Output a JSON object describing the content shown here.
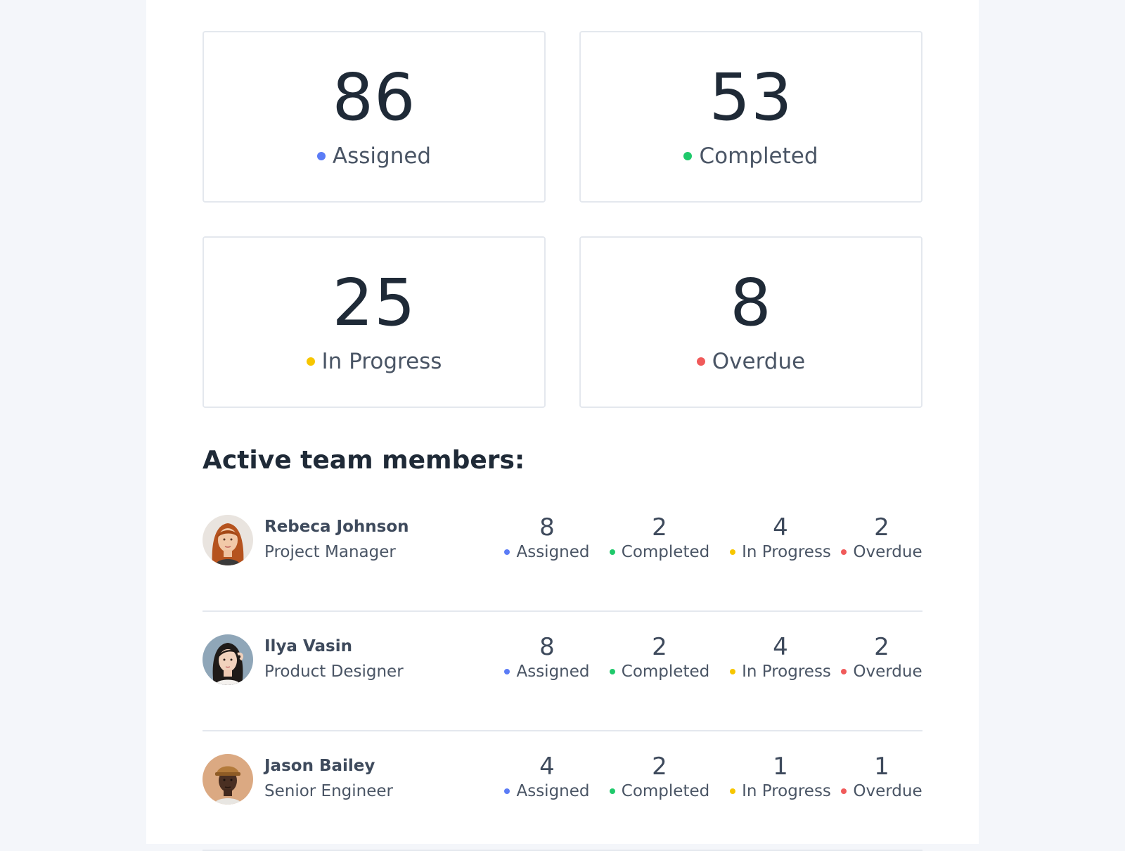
{
  "summary": {
    "assigned": {
      "value": "86",
      "label": "Assigned"
    },
    "completed": {
      "value": "53",
      "label": "Completed"
    },
    "in_progress": {
      "value": "25",
      "label": "In Progress"
    },
    "overdue": {
      "value": "8",
      "label": "Overdue"
    }
  },
  "colors": {
    "assigned": "#5b7cf6",
    "completed": "#1fc96b",
    "in_progress": "#f7c600",
    "overdue": "#f05a5a"
  },
  "section_title": "Active team members:",
  "stat_labels": {
    "assigned": "Assigned",
    "completed": "Completed",
    "in_progress": "In Progress",
    "overdue": "Overdue"
  },
  "members": [
    {
      "name": "Rebeca Johnson",
      "role": "Project Manager",
      "assigned": "8",
      "completed": "2",
      "in_progress": "4",
      "overdue": "2"
    },
    {
      "name": "Ilya Vasin",
      "role": "Product Designer",
      "assigned": "8",
      "completed": "2",
      "in_progress": "4",
      "overdue": "2"
    },
    {
      "name": "Jason Bailey",
      "role": "Senior Engineer",
      "assigned": "4",
      "completed": "2",
      "in_progress": "1",
      "overdue": "1"
    }
  ]
}
